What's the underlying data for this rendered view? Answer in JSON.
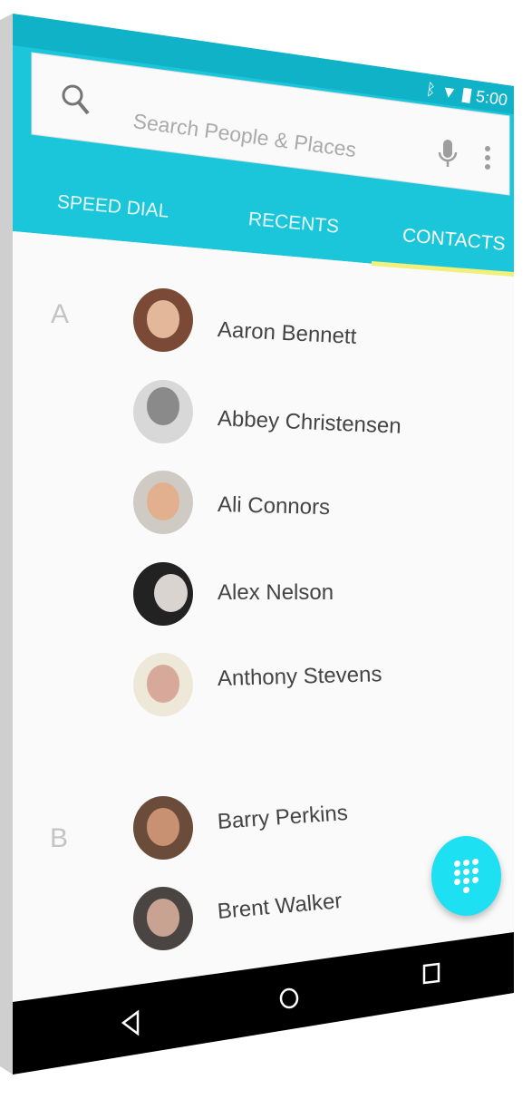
{
  "status_bar": {
    "time": "5:00",
    "icons": [
      "bluetooth-icon",
      "wifi-icon",
      "battery-icon"
    ]
  },
  "search": {
    "placeholder": "Search People  & Places",
    "icons": [
      "search-icon",
      "mic-icon",
      "more-vert-icon"
    ]
  },
  "tabs": [
    {
      "label": "SPEED DIAL"
    },
    {
      "label": "RECENTS"
    },
    {
      "label": "CONTACTS",
      "active": true
    }
  ],
  "sections": [
    {
      "letter": "A",
      "contacts": [
        {
          "name": "Aaron Bennett"
        },
        {
          "name": "Abbey Christensen"
        },
        {
          "name": "Ali Connors"
        },
        {
          "name": "Alex Nelson"
        },
        {
          "name": "Anthony Stevens"
        }
      ]
    },
    {
      "letter": "B",
      "contacts": [
        {
          "name": "Barry Perkins"
        },
        {
          "name": "Brent Walker"
        }
      ]
    }
  ],
  "fab": {
    "icon": "dialpad-icon"
  },
  "nav": {
    "icons": [
      "back-icon",
      "home-icon",
      "recents-icon"
    ]
  },
  "colors": {
    "header": "#1cc6da",
    "status": "#0fb2c6",
    "indicator": "#f0f07a",
    "fab": "#1de0f2"
  }
}
